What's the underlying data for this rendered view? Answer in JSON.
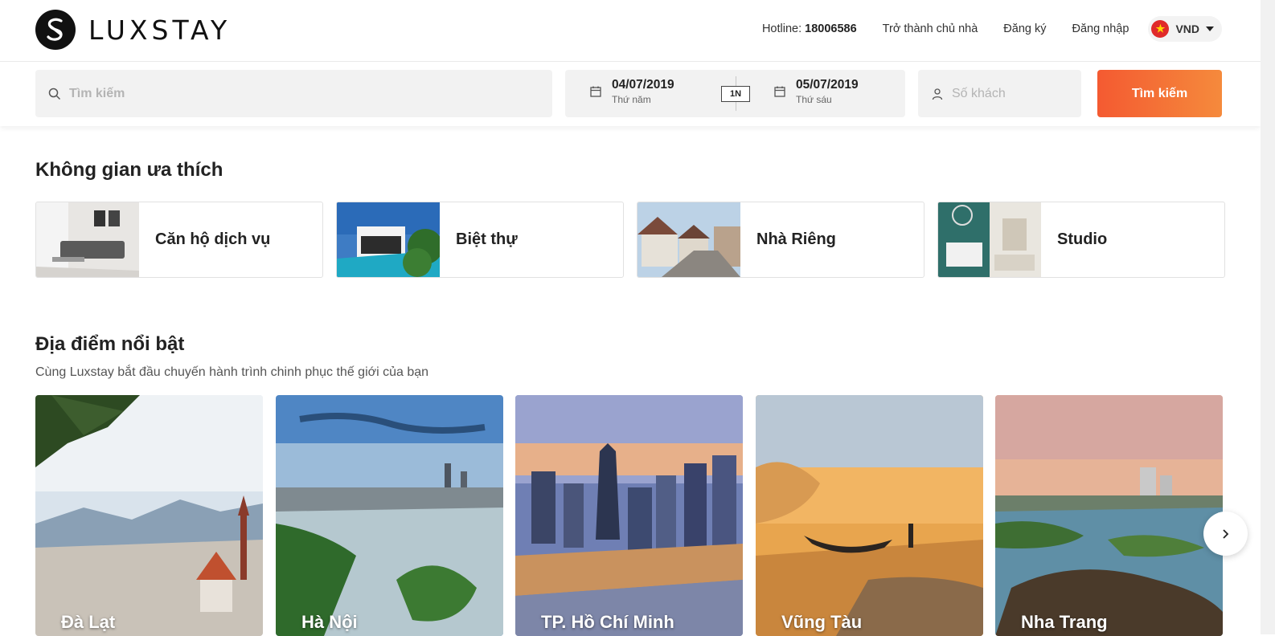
{
  "brand": {
    "name": "LUXSTAY"
  },
  "nav": {
    "hotline_label": "Hotline:",
    "hotline_number": "18006586",
    "become_host": "Trở thành chủ nhà",
    "register": "Đăng ký",
    "login": "Đăng nhập",
    "currency": "VND"
  },
  "search": {
    "placeholder": "Tìm kiếm",
    "checkin_date": "04/07/2019",
    "checkin_day": "Thứ năm",
    "nights": "1N",
    "checkout_date": "05/07/2019",
    "checkout_day": "Thứ sáu",
    "guests_placeholder": "Số khách",
    "button": "Tìm kiếm"
  },
  "categories": {
    "title": "Không gian ưa thích",
    "items": [
      {
        "label": "Căn hộ dịch vụ"
      },
      {
        "label": "Biệt thự"
      },
      {
        "label": "Nhà Riêng"
      },
      {
        "label": "Studio"
      }
    ]
  },
  "destinations": {
    "title": "Địa điểm nổi bật",
    "subtitle": "Cùng Luxstay bắt đầu chuyến hành trình chinh phục thế giới của bạn",
    "items": [
      {
        "name": "Đà Lạt"
      },
      {
        "name": "Hà Nội"
      },
      {
        "name": "TP. Hồ Chí Minh"
      },
      {
        "name": "Vũng Tàu"
      },
      {
        "name": "Nha Trang"
      }
    ]
  },
  "colors": {
    "accent": "#f45a31",
    "accent_end": "#f58a3c"
  },
  "icons": [
    "search-icon",
    "calendar-icon",
    "user-icon",
    "chevron-right-icon",
    "caret-down-icon",
    "vietnam-flag-icon"
  ]
}
